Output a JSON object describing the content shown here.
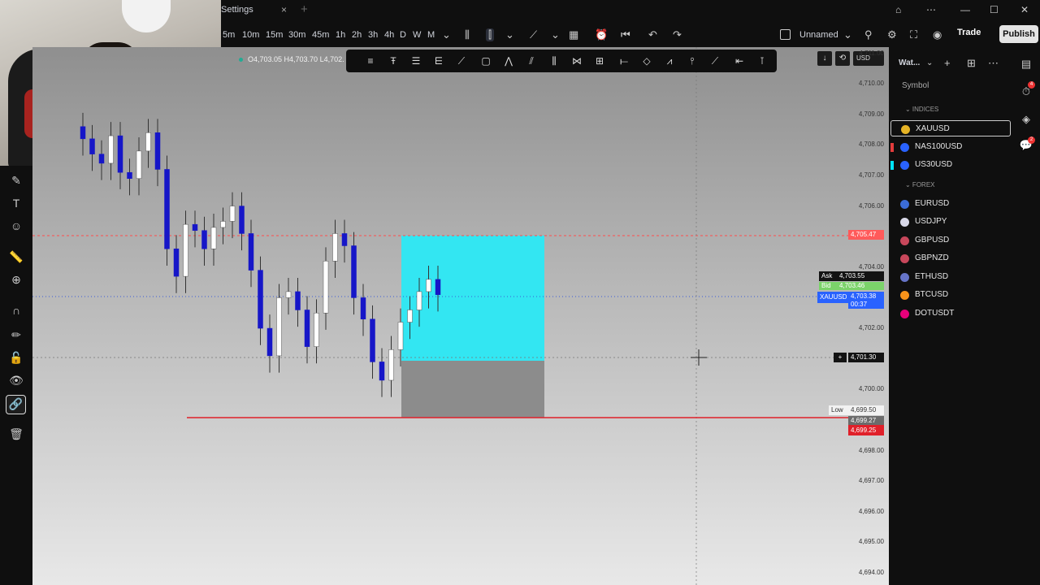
{
  "window": {
    "tab_title": "Settings",
    "tab_close": "×",
    "tab_add": "+",
    "controls": [
      "⌂",
      "⋯",
      "—",
      "☐",
      "✕"
    ]
  },
  "toolbar": {
    "timeframes": [
      "5m",
      "10m",
      "15m",
      "30m",
      "45m",
      "1h",
      "2h",
      "3h",
      "4h",
      "D",
      "W",
      "M"
    ],
    "layout_name": "Unnamed",
    "trade_label": "Trade",
    "publish_label": "Publish"
  },
  "chart": {
    "ohlc_text": "O4,703.05  H4,703.70  L4,702.",
    "currency": "USD",
    "price_ticks": [
      "4,711.00",
      "4,710.00",
      "4,709.00",
      "4,708.00",
      "4,707.00",
      "4,706.00",
      "4,705.00",
      "4,704.00",
      "4,703.00",
      "4,702.00",
      "4,701.00",
      "4,700.00",
      "4,699.00",
      "4,698.00",
      "4,697.00",
      "4,696.00",
      "4,695.00",
      "4,694.00"
    ],
    "tags": {
      "alert_price": "4,705.47",
      "ask_label": "Ask",
      "ask_price": "4,703.55",
      "bid_label": "Bid",
      "bid_price": "4,703.46",
      "symbol": "XAUUSD",
      "last_price": "4,703.38",
      "countdown": "00:37",
      "crosshair_price": "4,701.30",
      "low_label": "Low",
      "low_price": "4,699.50",
      "line_price_1": "4,699.27",
      "line_price_2": "4,699.25"
    },
    "colors": {
      "bull_candle": "#ffffff",
      "bear_candle": "#1616c8",
      "zone_top": "#33e6f2",
      "zone_bottom": "#8c8c8c",
      "support_line": "#e0202a",
      "alert_line": "#ff4d4d"
    }
  },
  "chart_data": {
    "type": "candlestick",
    "ylim": [
      4693.6,
      4711.2
    ],
    "candles_close_approx": [
      4708.2,
      4707.7,
      4707.4,
      4708.3,
      4707.1,
      4706.9,
      4707.8,
      4708.4,
      4707.2,
      4704.6,
      4703.7,
      4705.4,
      4705.2,
      4704.6,
      4705.3,
      4705.5,
      4706.0,
      4705.1,
      4703.9,
      4702.0,
      4701.1,
      4703.0,
      4703.2,
      4702.6,
      4701.4,
      4702.5,
      4704.2,
      4705.1,
      4704.7,
      4703.0,
      4702.3,
      4700.9,
      4700.3,
      4701.3,
      4702.2,
      4702.6,
      4703.2,
      4703.6,
      4703.1
    ]
  },
  "watchlist": {
    "title": "Wat...",
    "symbol_header": "Symbol",
    "sections": [
      {
        "name": "INDICES",
        "items": [
          {
            "symbol": "XAUUSD",
            "color": "#e6b325",
            "flag": "",
            "selected": true
          },
          {
            "symbol": "NAS100USD",
            "color": "#2962ff",
            "flag": "#e33c3c",
            "selected": false
          },
          {
            "symbol": "US30USD",
            "color": "#2962ff",
            "flag": "#00e5ff",
            "selected": false
          }
        ]
      },
      {
        "name": "FOREX",
        "items": [
          {
            "symbol": "EURUSD",
            "color": "#3b6cd8",
            "flag": "",
            "selected": false
          },
          {
            "symbol": "USDJPY",
            "color": "#d8d8e8",
            "flag": "",
            "selected": false
          },
          {
            "symbol": "GBPUSD",
            "color": "#c8475b",
            "flag": "",
            "selected": false
          },
          {
            "symbol": "GBPNZD",
            "color": "#c8475b",
            "flag": "",
            "selected": false
          },
          {
            "symbol": "ETHUSD",
            "color": "#6674c8",
            "flag": "",
            "selected": false
          },
          {
            "symbol": "BTCUSD",
            "color": "#f7931a",
            "flag": "",
            "selected": false
          },
          {
            "symbol": "DOTUSDT",
            "color": "#e6007a",
            "flag": "",
            "selected": false
          }
        ]
      }
    ]
  },
  "rightbar": {
    "badges": [
      "4",
      "2"
    ]
  }
}
